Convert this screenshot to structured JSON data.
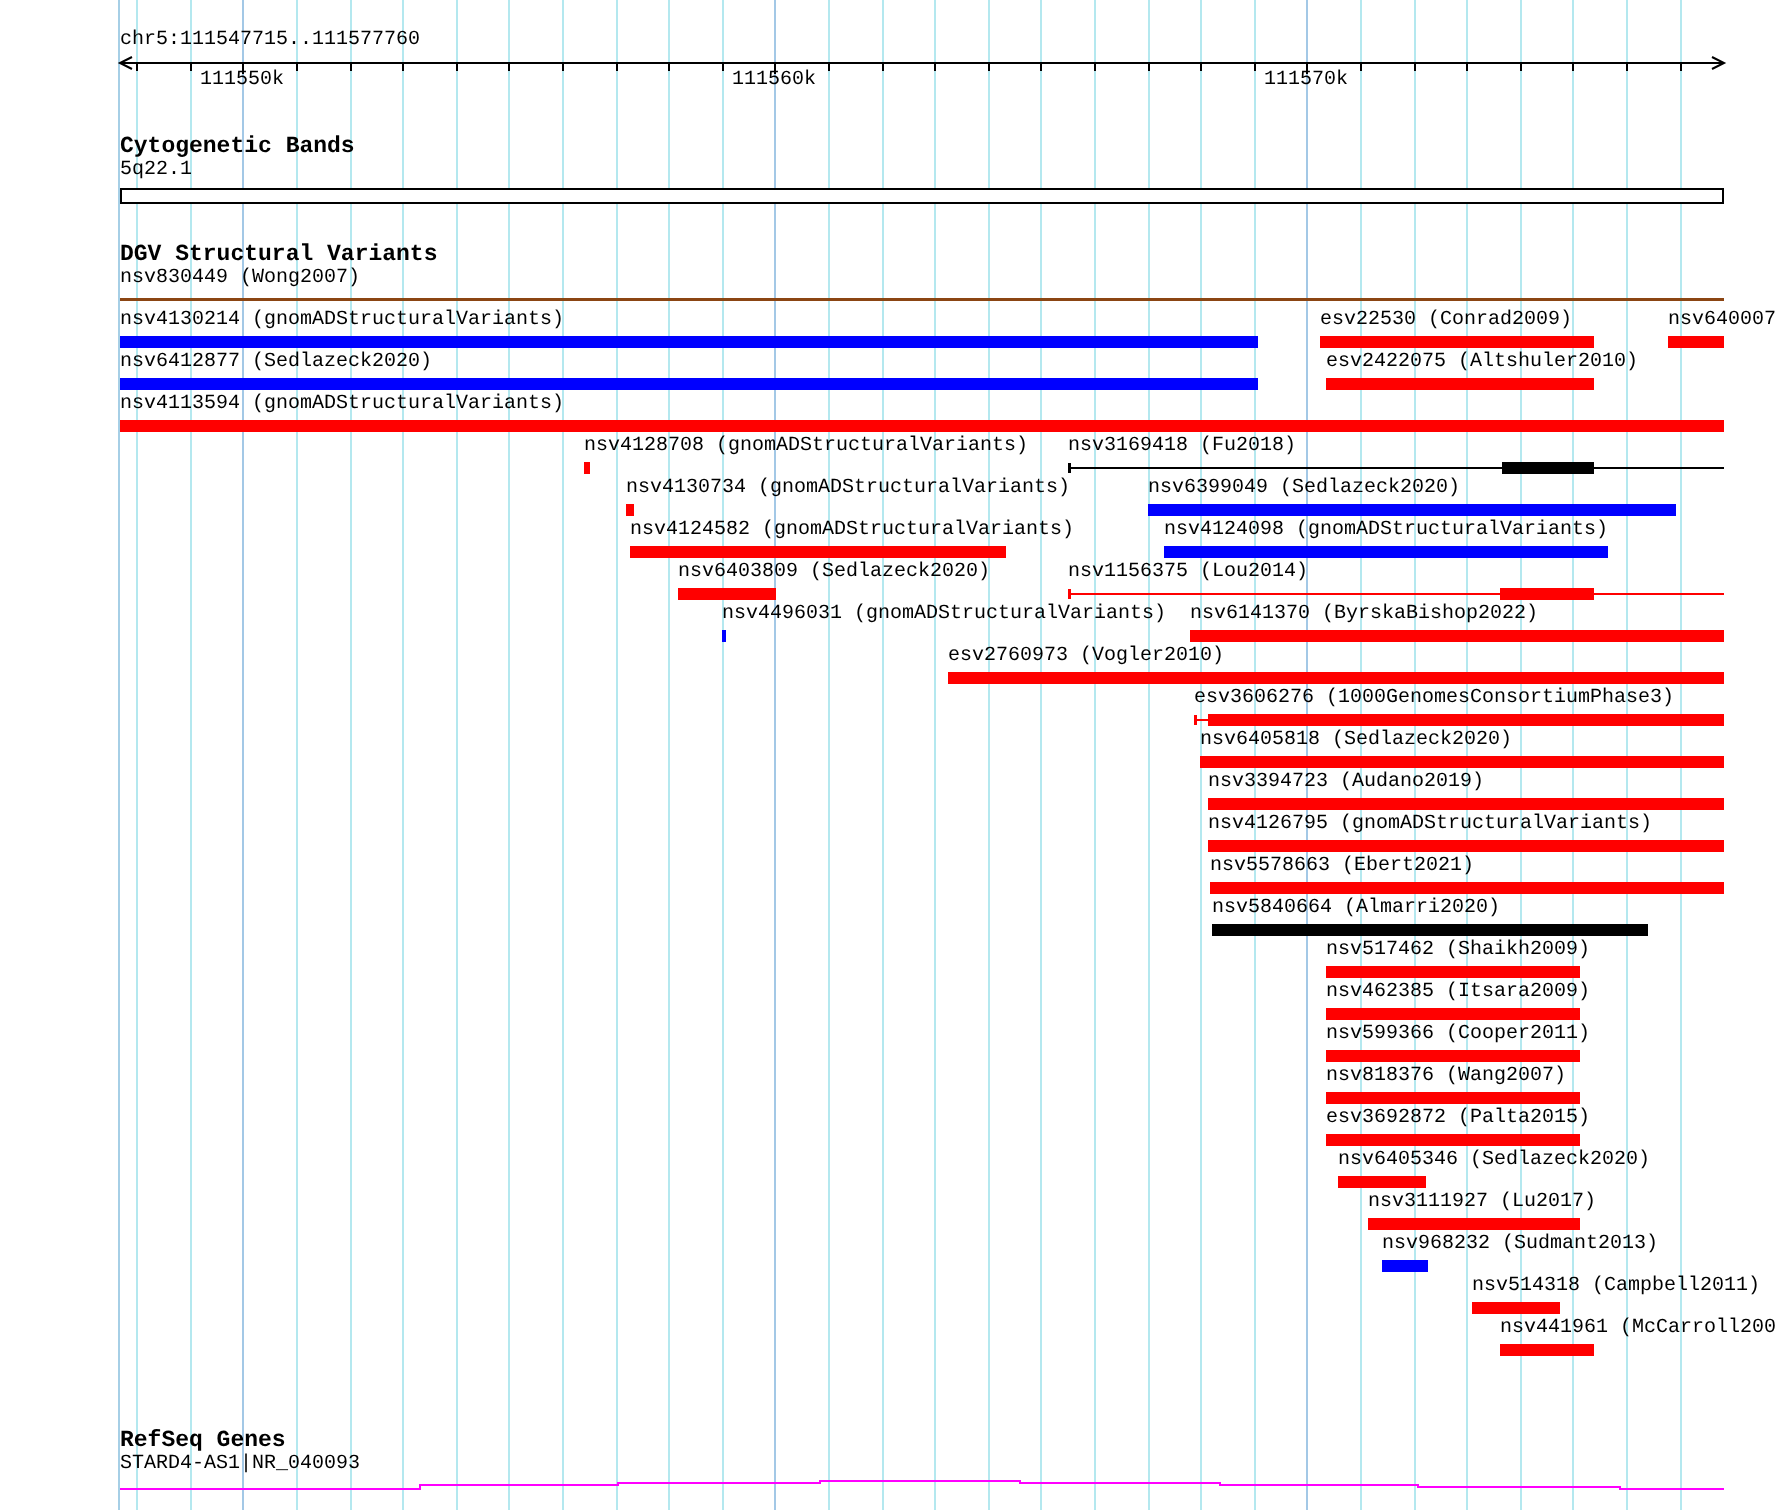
{
  "ruler": {
    "location": "chr5:111547715..111577760",
    "tick_labels": [
      "111550k",
      "111560k",
      "111570k"
    ]
  },
  "tracks": [
    {
      "kind": "bands",
      "title": "Cytogenetic Bands",
      "features": [
        {
          "label": "5q22.1"
        }
      ]
    },
    {
      "kind": "variants",
      "title": "DGV Structural Variants",
      "rows": [
        {
          "features": [
            {
              "label": "nsv830449 (Wong2007)",
              "kind": "line",
              "color": "#8b4513"
            }
          ]
        },
        {
          "features": [
            {
              "label": "nsv4130214 (gnomADStructuralVariants)",
              "kind": "bar",
              "color": "#0000ff"
            },
            {
              "label": "esv22530 (Conrad2009)",
              "kind": "bar",
              "color": "#ff0000"
            },
            {
              "label": "nsv640007",
              "kind": "bar",
              "color": "#ff0000"
            }
          ]
        },
        {
          "features": [
            {
              "label": "nsv6412877 (Sedlazeck2020)",
              "kind": "bar",
              "color": "#0000ff"
            },
            {
              "label": "esv2422075 (Altshuler2010)",
              "kind": "bar",
              "color": "#ff0000"
            }
          ]
        },
        {
          "features": [
            {
              "label": "nsv4113594 (gnomADStructuralVariants)",
              "kind": "bar",
              "color": "#ff0000"
            }
          ]
        },
        {
          "features": [
            {
              "label": "nsv4128708 (gnomADStructuralVariants)",
              "kind": "bar",
              "color": "#ff0000"
            },
            {
              "label": "nsv3169418 (Fu2018)",
              "kind": "gapped",
              "color": "#000000"
            }
          ]
        },
        {
          "features": [
            {
              "label": "nsv4130734 (gnomADStructuralVariants)",
              "kind": "bar",
              "color": "#ff0000"
            },
            {
              "label": "nsv6399049 (Sedlazeck2020)",
              "kind": "bar",
              "color": "#0000ff"
            }
          ]
        },
        {
          "features": [
            {
              "label": "nsv4124582 (gnomADStructuralVariants)",
              "kind": "bar",
              "color": "#ff0000"
            },
            {
              "label": "nsv4124098 (gnomADStructuralVariants)",
              "kind": "bar",
              "color": "#0000ff"
            }
          ]
        },
        {
          "features": [
            {
              "label": "nsv6403809 (Sedlazeck2020)",
              "kind": "bar",
              "color": "#ff0000"
            },
            {
              "label": "nsv1156375 (Lou2014)",
              "kind": "gapped",
              "color": "#ff0000"
            }
          ]
        },
        {
          "features": [
            {
              "label": "nsv4496031 (gnomADStructuralVariants)",
              "kind": "bar",
              "color": "#0000ff"
            },
            {
              "label": "nsv6141370 (ByrskaBishop2022)",
              "kind": "bar",
              "color": "#ff0000"
            }
          ]
        },
        {
          "features": [
            {
              "label": "esv2760973 (Vogler2010)",
              "kind": "bar",
              "color": "#ff0000"
            }
          ]
        },
        {
          "features": [
            {
              "label": "esv3606276 (1000GenomesConsortiumPhase3)",
              "kind": "gapped",
              "color": "#ff0000"
            }
          ]
        },
        {
          "features": [
            {
              "label": "nsv6405818 (Sedlazeck2020)",
              "kind": "bar",
              "color": "#ff0000"
            }
          ]
        },
        {
          "features": [
            {
              "label": "nsv3394723 (Audano2019)",
              "kind": "bar",
              "color": "#ff0000"
            }
          ]
        },
        {
          "features": [
            {
              "label": "nsv4126795 (gnomADStructuralVariants)",
              "kind": "bar",
              "color": "#ff0000"
            }
          ]
        },
        {
          "features": [
            {
              "label": "nsv5578663 (Ebert2021)",
              "kind": "bar",
              "color": "#ff0000"
            }
          ]
        },
        {
          "features": [
            {
              "label": "nsv5840664 (Almarri2020)",
              "kind": "bar",
              "color": "#000000"
            }
          ]
        },
        {
          "features": [
            {
              "label": "nsv517462 (Shaikh2009)",
              "kind": "bar",
              "color": "#ff0000"
            }
          ]
        },
        {
          "features": [
            {
              "label": "nsv462385 (Itsara2009)",
              "kind": "bar",
              "color": "#ff0000"
            }
          ]
        },
        {
          "features": [
            {
              "label": "nsv599366 (Cooper2011)",
              "kind": "bar",
              "color": "#ff0000"
            }
          ]
        },
        {
          "features": [
            {
              "label": "nsv818376 (Wang2007)",
              "kind": "bar",
              "color": "#ff0000"
            }
          ]
        },
        {
          "features": [
            {
              "label": "esv3692872 (Palta2015)",
              "kind": "bar",
              "color": "#ff0000"
            }
          ]
        },
        {
          "features": [
            {
              "label": "nsv6405346 (Sedlazeck2020)",
              "kind": "bar",
              "color": "#ff0000"
            }
          ]
        },
        {
          "features": [
            {
              "label": "nsv3111927 (Lu2017)",
              "kind": "bar",
              "color": "#ff0000"
            }
          ]
        },
        {
          "features": [
            {
              "label": "nsv968232 (Sudmant2013)",
              "kind": "bar",
              "color": "#0000ff"
            }
          ]
        },
        {
          "features": [
            {
              "label": "nsv514318 (Campbell2011)",
              "kind": "bar",
              "color": "#ff0000"
            }
          ]
        },
        {
          "features": [
            {
              "label": "nsv441961 (McCarroll200",
              "kind": "bar",
              "color": "#ff0000"
            }
          ]
        }
      ]
    },
    {
      "kind": "genes",
      "title": "RefSeq Genes",
      "features": [
        {
          "label": "STARD4-AS1|NR_040093"
        }
      ]
    }
  ]
}
